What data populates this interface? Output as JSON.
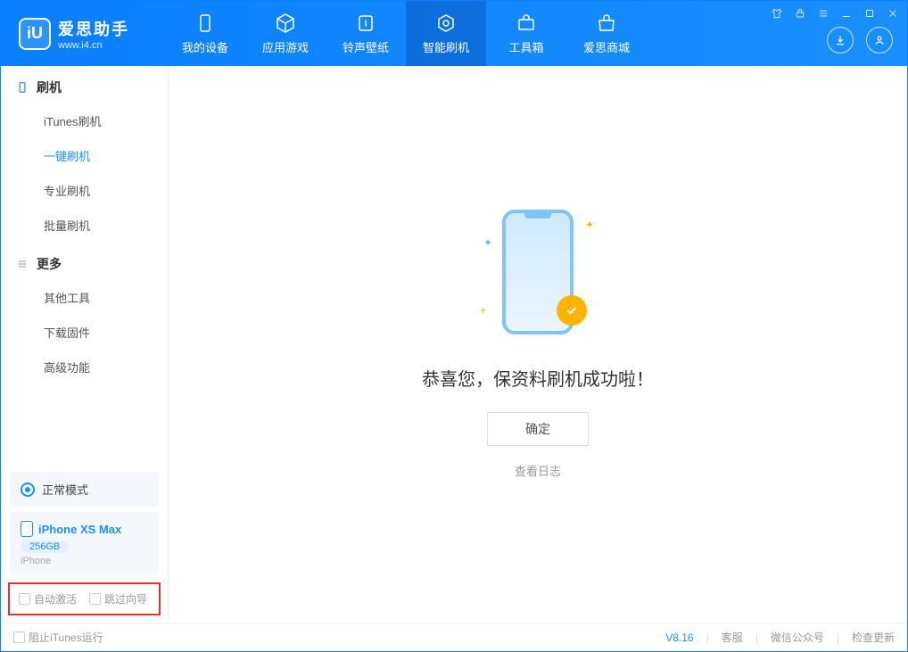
{
  "app": {
    "title": "爱思助手",
    "subtitle": "www.i4.cn"
  },
  "nav": {
    "items": [
      {
        "label": "我的设备"
      },
      {
        "label": "应用游戏"
      },
      {
        "label": "铃声壁纸"
      },
      {
        "label": "智能刷机"
      },
      {
        "label": "工具箱"
      },
      {
        "label": "爱思商城"
      }
    ],
    "active_index": 3
  },
  "sidebar": {
    "section1": {
      "title": "刷机",
      "items": [
        {
          "label": "iTunes刷机"
        },
        {
          "label": "一键刷机"
        },
        {
          "label": "专业刷机"
        },
        {
          "label": "批量刷机"
        }
      ],
      "active_index": 1
    },
    "section2": {
      "title": "更多",
      "items": [
        {
          "label": "其他工具"
        },
        {
          "label": "下载固件"
        },
        {
          "label": "高级功能"
        }
      ]
    },
    "mode": {
      "label": "正常模式"
    },
    "device": {
      "name": "iPhone XS Max",
      "storage": "256GB",
      "type": "iPhone"
    },
    "options": {
      "auto_activate": "自动激活",
      "skip_guide": "跳过向导"
    }
  },
  "content": {
    "success_message": "恭喜您，保资料刷机成功啦！",
    "ok_button": "确定",
    "view_log": "查看日志"
  },
  "statusbar": {
    "block_itunes": "阻止iTunes运行",
    "version": "V8.16",
    "customer_service": "客服",
    "wechat": "微信公众号",
    "check_update": "检查更新"
  }
}
